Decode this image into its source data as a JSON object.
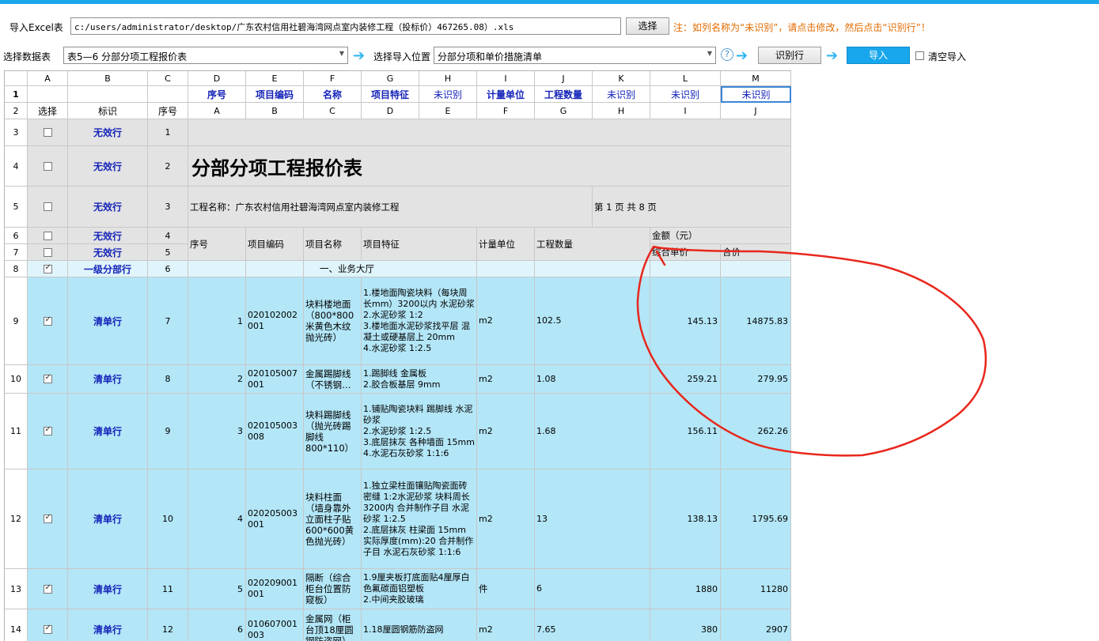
{
  "toolbar": {
    "import_excel_label": "导入Excel表",
    "file_path": "c:/users/administrator/desktop/广东农村信用社碧海湾网点室内装修工程（投标价）467265.08）.xls",
    "choose_button": "选择",
    "note": "注：如列名称为“未识别”，请点击修改，然后点击“识别行”！",
    "select_sheet_label": "选择数据表",
    "sheet_value": "表5—6 分部分项工程报价表",
    "select_position_label": "选择导入位置",
    "position_value": "分部分项和单价措施清单",
    "help_icon": "?",
    "identify_row_button": "识别行",
    "import_button": "导入",
    "clear_import_label": "清空导入",
    "clear_import_checked": false
  },
  "columns": [
    {
      "letter": "A",
      "field": "",
      "row2": "选择"
    },
    {
      "letter": "B",
      "field": "",
      "row2": "标识"
    },
    {
      "letter": "C",
      "field": "",
      "row2": "序号"
    },
    {
      "letter": "D",
      "field": "序号",
      "row2": "A"
    },
    {
      "letter": "E",
      "field": "项目编码",
      "row2": "B"
    },
    {
      "letter": "F",
      "field": "名称",
      "row2": "C"
    },
    {
      "letter": "G",
      "field": "项目特征",
      "row2": "D"
    },
    {
      "letter": "H",
      "field": "未识别",
      "row2": "E"
    },
    {
      "letter": "I",
      "field": "计量单位",
      "row2": "F"
    },
    {
      "letter": "J",
      "field": "工程数量",
      "row2": "G"
    },
    {
      "letter": "K",
      "field": "未识别",
      "row2": "H"
    },
    {
      "letter": "L",
      "field": "未识别",
      "row2": "I"
    },
    {
      "letter": "M",
      "field": "未识别",
      "row2": "J"
    }
  ],
  "rownums": [
    "1",
    "2",
    "3",
    "4",
    "5",
    "6",
    "7",
    "8",
    "9",
    "10",
    "11",
    "12",
    "13",
    "14"
  ],
  "rows": {
    "r3": {
      "checked": false,
      "tag": "无效行",
      "seq": "1"
    },
    "r4": {
      "checked": false,
      "tag": "无效行",
      "seq": "2",
      "title": "分部分项工程报价表"
    },
    "r5": {
      "checked": false,
      "tag": "无效行",
      "seq": "3",
      "project": "工程名称：广东农村信用社碧海湾网点室内装修工程",
      "page": "第 1 页 共 8 页"
    },
    "r6": {
      "checked": false,
      "tag": "无效行",
      "seq": "4",
      "amount": "金额（元）"
    },
    "r7": {
      "checked": false,
      "tag": "无效行",
      "seq": "5",
      "unit_price": "综合单价",
      "total": "合价"
    },
    "hdr67": {
      "no": "序号",
      "code": "项目编码",
      "name": "项目名称",
      "feature": "项目特征",
      "unit": "计量单位",
      "qty": "工程数量"
    },
    "r8": {
      "checked": true,
      "tag": "一级分部行",
      "seq": "6",
      "name": "一、业务大厅"
    },
    "r9": {
      "checked": true,
      "tag": "清单行",
      "seq": "7",
      "no": "1",
      "code": "020102002001",
      "name": "块料楼地面（800*800米黄色木纹抛光砖）",
      "feature": "1.楼地面陶瓷块料（每块周长mm）3200以内 水泥砂浆\n2.水泥砂浆 1:2\n3.楼地面水泥砂浆找平层 混凝土或硬基层上 20mm\n4.水泥砂浆 1:2.5",
      "unit": "m2",
      "qty": "102.5",
      "price": "145.13",
      "total": "14875.83"
    },
    "r10": {
      "checked": true,
      "tag": "清单行",
      "seq": "8",
      "no": "2",
      "code": "020105007001",
      "name": "金属踢脚线（不锈钢…",
      "feature": "1.踢脚线 金属板\n2.胶合板基层 9mm",
      "unit": "m2",
      "qty": "1.08",
      "price": "259.21",
      "total": "279.95"
    },
    "r11": {
      "checked": true,
      "tag": "清单行",
      "seq": "9",
      "no": "3",
      "code": "020105003008",
      "name": "块料踢脚线（抛光砖踢脚线 800*110）",
      "feature": "1.铺贴陶瓷块料 踢脚线 水泥砂浆\n2.水泥砂浆 1:2.5\n3.底层抹灰 各种墙面 15mm\n4.水泥石灰砂浆 1:1:6",
      "unit": "m2",
      "qty": "1.68",
      "price": "156.11",
      "total": "262.26"
    },
    "r12": {
      "checked": true,
      "tag": "清单行",
      "seq": "10",
      "no": "4",
      "code": "020205003001",
      "name": "块料柱面（墙身靠外立面柱子贴600*600黄色抛光砖）",
      "feature": "1.独立梁柱面镶贴陶瓷面砖密缝 1:2水泥砂浆 块料周长3200内 合并制作子目 水泥砂浆 1:2.5\n2.底层抹灰 柱梁面 15mm 实际厚度(mm):20 合并制作子目 水泥石灰砂浆 1:1:6",
      "unit": "m2",
      "qty": "13",
      "price": "138.13",
      "total": "1795.69"
    },
    "r13": {
      "checked": true,
      "tag": "清单行",
      "seq": "11",
      "no": "5",
      "code": "020209001001",
      "name": "隔断（综合柜台位置防窥板）",
      "feature": "1.9厘夹板打底面贴4厘厚白色氟碳面铝塑板\n2.中间夹胶玻璃",
      "unit": "件",
      "qty": "6",
      "price": "1880",
      "total": "11280"
    },
    "r14": {
      "checked": true,
      "tag": "清单行",
      "seq": "12",
      "no": "6",
      "code": "010607001003",
      "name": "金属网（柜台顶18厘圆钢防盗网）",
      "feature": "1.18厘圆钢筋防盗网",
      "unit": "m2",
      "qty": "7.65",
      "price": "380",
      "total": "2907"
    }
  },
  "colors": {
    "accent": "#1aa7ec",
    "note": "#e36b00",
    "field": "#1423b8",
    "row_cyan": "#b3e6f7",
    "row_gray": "#e3e3e3",
    "annotation": "#e8271c"
  }
}
